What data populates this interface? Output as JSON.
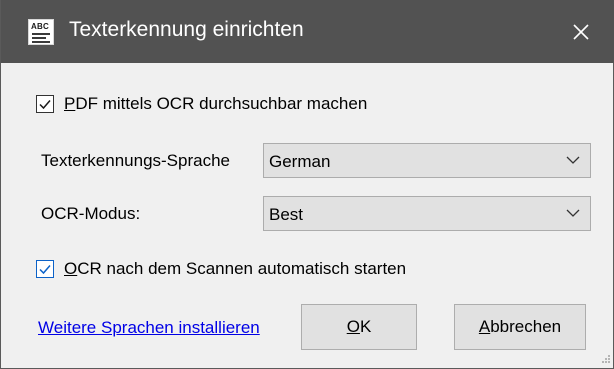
{
  "window": {
    "title": "Texterkennung einrichten",
    "app_icon_text": "ABC",
    "titlebar_color": "#525252"
  },
  "ocr_searchable": {
    "checked": true,
    "label_accel": "P",
    "label_rest": "DF mittels OCR durchsuchbar machen"
  },
  "language": {
    "label": "Texterkennungs-Sprache",
    "value": "German"
  },
  "mode": {
    "label": "OCR-Modus:",
    "value": "Best"
  },
  "auto_start": {
    "checked": true,
    "label_accel": "O",
    "label_rest": "CR nach dem Scannen automatisch starten"
  },
  "footer": {
    "install_link": "Weitere Sprachen installieren",
    "ok_accel": "O",
    "ok_rest": "K",
    "cancel_accel": "A",
    "cancel_rest": "bbrechen"
  }
}
